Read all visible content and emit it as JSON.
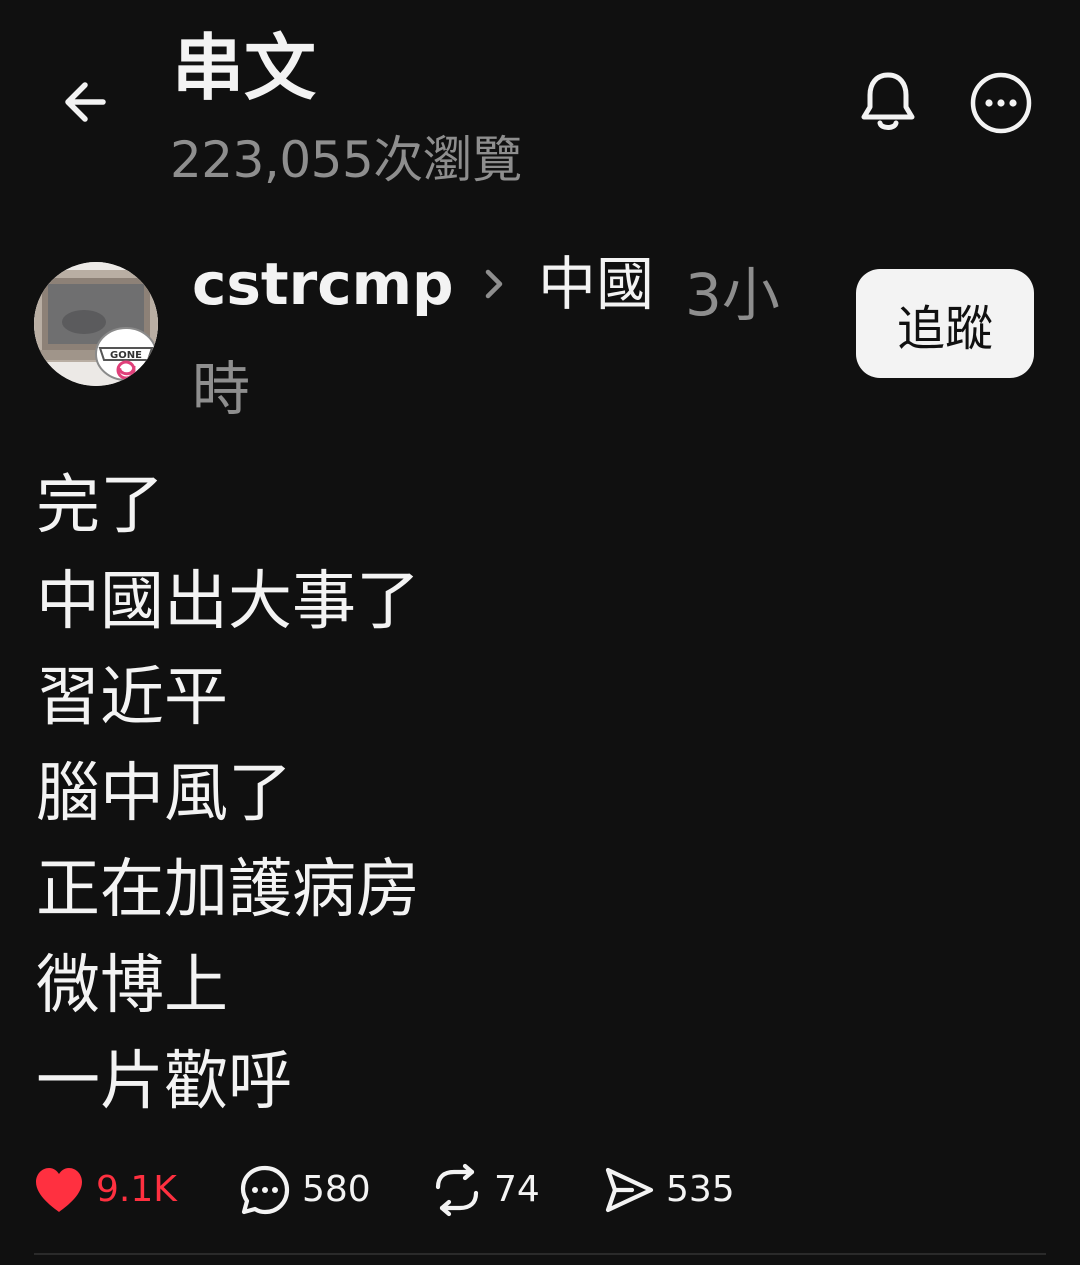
{
  "header": {
    "title": "串文",
    "view_count": "223,055次瀏覽",
    "back_icon": "arrow-left-icon",
    "notify_icon": "bell-icon",
    "more_icon": "ellipsis-circle-icon"
  },
  "author": {
    "username": "cstrcmp",
    "topic": "中國",
    "time": "3小時",
    "follow_label": "追蹤",
    "avatar_badge_text": "GONE"
  },
  "post": {
    "lines": [
      "完了",
      "中國出大事了",
      "習近平",
      "腦中風了",
      "正在加護病房",
      "微博上",
      "一片歡呼"
    ]
  },
  "actions": {
    "likes": "9.1K",
    "comments": "580",
    "reposts": "74",
    "shares": "535",
    "liked": true
  },
  "colors": {
    "background": "#101010",
    "text": "#f3f3f3",
    "muted": "#8e8e8e",
    "like": "#ff3040",
    "follow_bg": "#f3f3f3"
  }
}
